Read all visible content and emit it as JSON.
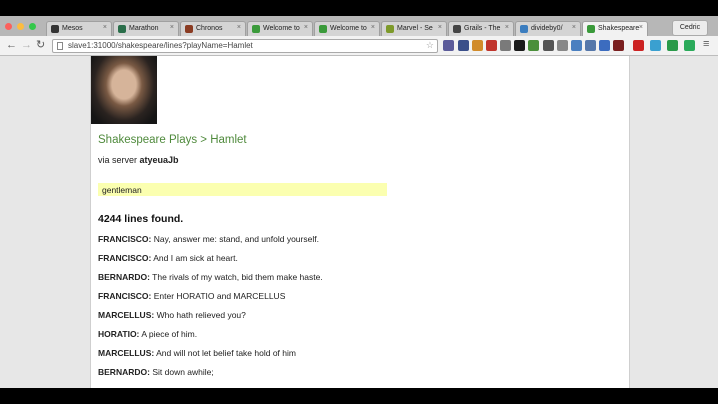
{
  "browser": {
    "tabs": [
      {
        "label": "Mesos",
        "color": "#333333"
      },
      {
        "label": "Marathon",
        "color": "#2a6e4a"
      },
      {
        "label": "Chronos",
        "color": "#8a3b22"
      },
      {
        "label": "Welcome to",
        "color": "#3a9a3a"
      },
      {
        "label": "Welcome to",
        "color": "#3a9a3a"
      },
      {
        "label": "Marvel - Se",
        "color": "#7d9a2a"
      },
      {
        "label": "Grails - The",
        "color": "#444444"
      },
      {
        "label": "divideby0/",
        "color": "#3b7dbf"
      },
      {
        "label": "Shakespeare",
        "color": "#3a9a3a"
      }
    ],
    "profile_name": "Cedric",
    "url": "slave1:31000/shakespeare/lines?playName=Hamlet"
  },
  "page": {
    "breadcrumb": "Shakespeare Plays > Hamlet",
    "server_prefix": "via server",
    "server_name": "atyeuaJb",
    "search_value": "gentleman",
    "result_count": "4244 lines found.",
    "lines": [
      {
        "speaker": "FRANCISCO:",
        "text": "Nay, answer me: stand, and unfold yourself."
      },
      {
        "speaker": "FRANCISCO:",
        "text": "And I am sick at heart."
      },
      {
        "speaker": "BERNARDO:",
        "text": "The rivals of my watch, bid them make haste."
      },
      {
        "speaker": "FRANCISCO:",
        "text": "Enter HORATIO and MARCELLUS"
      },
      {
        "speaker": "MARCELLUS:",
        "text": "Who hath relieved you?"
      },
      {
        "speaker": "HORATIO:",
        "text": "A piece of him."
      },
      {
        "speaker": "MARCELLUS:",
        "text": "And will not let belief take hold of him"
      },
      {
        "speaker": "BERNARDO:",
        "text": "Sit down awhile;"
      }
    ]
  }
}
